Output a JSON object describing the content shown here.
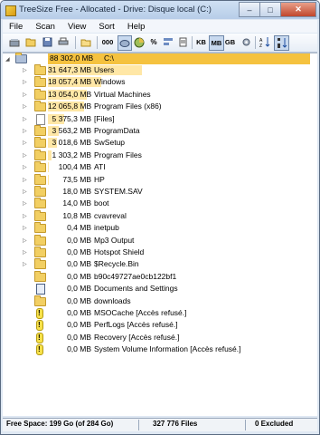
{
  "window": {
    "title": "TreeSize Free - Allocated - Drive: Disque local (C:)",
    "minimize_glyph": "–",
    "maximize_glyph": "□",
    "close_glyph": "✕"
  },
  "menu": [
    "File",
    "Scan",
    "View",
    "Sort",
    "Help"
  ],
  "toolbar": {
    "size_units": [
      "KB",
      "MB",
      "GB"
    ],
    "selected_unit": "MB",
    "number_format_label": "000",
    "percent_label": "%"
  },
  "tree": {
    "root": {
      "size": "88 302,0 MB",
      "path": "C:\\"
    },
    "items": [
      {
        "size": "31 647,3 MB",
        "name": "Users",
        "icon": "folder",
        "expandable": true,
        "fraction": 0.358
      },
      {
        "size": "18 057,4 MB",
        "name": "Windows",
        "icon": "folder",
        "expandable": true,
        "fraction": 0.205
      },
      {
        "size": "13 054,0 MB",
        "name": "Virtual Machines",
        "icon": "folder",
        "expandable": true,
        "fraction": 0.148
      },
      {
        "size": "12 065,8 MB",
        "name": "Program Files (x86)",
        "icon": "folder",
        "expandable": true,
        "fraction": 0.137
      },
      {
        "size": "5 375,3 MB",
        "name": "[Files]",
        "icon": "file",
        "expandable": true,
        "fraction": 0.061
      },
      {
        "size": "3 563,2 MB",
        "name": "ProgramData",
        "icon": "folder",
        "expandable": true,
        "fraction": 0.04
      },
      {
        "size": "3 018,6 MB",
        "name": "SwSetup",
        "icon": "folder",
        "expandable": true,
        "fraction": 0.034
      },
      {
        "size": "1 303,2 MB",
        "name": "Program Files",
        "icon": "folder",
        "expandable": true,
        "fraction": 0.015
      },
      {
        "size": "100,4 MB",
        "name": "ATI",
        "icon": "folder",
        "expandable": true,
        "fraction": 0.001
      },
      {
        "size": "73,5 MB",
        "name": "HP",
        "icon": "folder",
        "expandable": true,
        "fraction": 0.001
      },
      {
        "size": "18,0 MB",
        "name": "SYSTEM.SAV",
        "icon": "folder",
        "expandable": true,
        "fraction": 0.0
      },
      {
        "size": "14,0 MB",
        "name": "boot",
        "icon": "folder",
        "expandable": true,
        "fraction": 0.0
      },
      {
        "size": "10,8 MB",
        "name": "cvavreval",
        "icon": "folder",
        "expandable": true,
        "fraction": 0.0
      },
      {
        "size": "0,4 MB",
        "name": "inetpub",
        "icon": "folder",
        "expandable": true,
        "fraction": 0.0
      },
      {
        "size": "0,0 MB",
        "name": "Mp3 Output",
        "icon": "folder",
        "expandable": true,
        "fraction": 0.0
      },
      {
        "size": "0,0 MB",
        "name": "Hotspot Shield",
        "icon": "folder",
        "expandable": true,
        "fraction": 0.0
      },
      {
        "size": "0,0 MB",
        "name": "$Recycle.Bin",
        "icon": "folder",
        "expandable": true,
        "fraction": 0.0
      },
      {
        "size": "0,0 MB",
        "name": "b90c49727ae0cb122bf1",
        "icon": "folder",
        "expandable": false,
        "fraction": 0.0
      },
      {
        "size": "0,0 MB",
        "name": "Documents and Settings",
        "icon": "shortcut",
        "expandable": false,
        "fraction": 0.0
      },
      {
        "size": "0,0 MB",
        "name": "downloads",
        "icon": "folder",
        "expandable": false,
        "fraction": 0.0
      },
      {
        "size": "0,0 MB",
        "name": "MSOCache  [Accès refusé.]",
        "icon": "warning",
        "expandable": false,
        "fraction": 0.0
      },
      {
        "size": "0,0 MB",
        "name": "PerfLogs  [Accès refusé.]",
        "icon": "warning",
        "expandable": false,
        "fraction": 0.0
      },
      {
        "size": "0,0 MB",
        "name": "Recovery  [Accès refusé.]",
        "icon": "warning",
        "expandable": false,
        "fraction": 0.0
      },
      {
        "size": "0,0 MB",
        "name": "System Volume Information  [Accès refusé.]",
        "icon": "warning",
        "expandable": false,
        "fraction": 0.0
      }
    ]
  },
  "status": {
    "free_space": "Free Space: 199 Go  (of 284 Go)",
    "files": "327 776  Files",
    "excluded": "0 Excluded"
  }
}
